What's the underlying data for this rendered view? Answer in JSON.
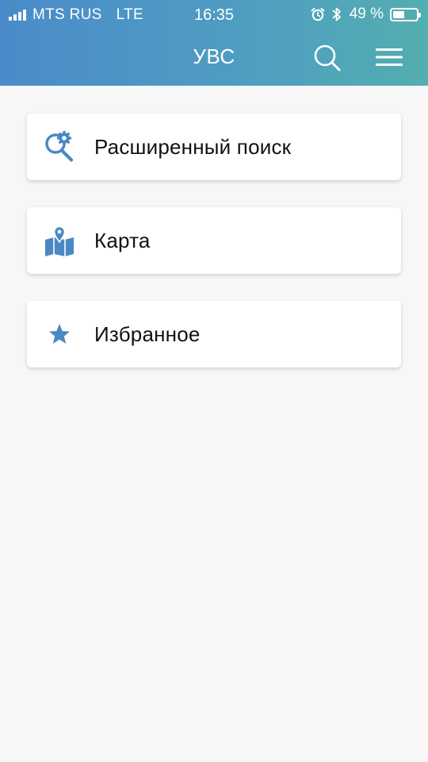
{
  "status_bar": {
    "carrier": "MTS RUS",
    "network": "LTE",
    "time": "16:35",
    "battery_percent": "49 %",
    "battery_level": 0.49,
    "icons": [
      "signal-icon",
      "alarm-icon",
      "bluetooth-icon",
      "battery-icon"
    ]
  },
  "header": {
    "title": "УВС",
    "search_icon": "search-icon",
    "menu_icon": "hamburger-menu-icon"
  },
  "menu": {
    "items": [
      {
        "label": "Расширенный поиск",
        "icon": "advanced-search-icon"
      },
      {
        "label": "Карта",
        "icon": "map-icon"
      },
      {
        "label": "Избранное",
        "icon": "star-icon"
      }
    ]
  },
  "colors": {
    "header_gradient_start": "#4a8bc9",
    "header_gradient_end": "#53aeb0",
    "icon_accent": "#4a88c4",
    "background": "#f7f7f7",
    "card_background": "#ffffff"
  }
}
